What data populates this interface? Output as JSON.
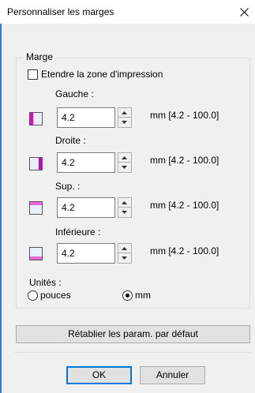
{
  "window": {
    "title": "Personnaliser les marges"
  },
  "close_icon": "close-icon",
  "group": {
    "legend": "Marge",
    "extend_checkbox": {
      "label": "Etendre la zone d'impression",
      "checked": false
    }
  },
  "margins": [
    {
      "label": "Gauche :",
      "value": "4.2",
      "range": "mm [4.2 - 100.0]",
      "icon": "margin-left-icon",
      "highlight_color": "#e800c8"
    },
    {
      "label": "Droite :",
      "value": "4.2",
      "range": "mm [4.2 - 100.0]",
      "icon": "margin-right-icon",
      "highlight_color": "#c800c8"
    },
    {
      "label": "Sup. :",
      "value": "4.2",
      "range": "mm [4.2 - 100.0]",
      "icon": "margin-top-icon",
      "highlight_color": "#e868d8"
    },
    {
      "label": "Inférieure :",
      "value": "4.2",
      "range": "mm [4.2 - 100.0]",
      "icon": "margin-bottom-icon",
      "highlight_color": "#e868d8"
    }
  ],
  "units": {
    "label": "Unités :",
    "options": [
      {
        "label": "pouces",
        "selected": false
      },
      {
        "label": "mm",
        "selected": true
      }
    ]
  },
  "buttons": {
    "reset": "Rétablier les param. par défaut",
    "ok": "OK",
    "cancel": "Annuler"
  },
  "colors": {
    "window_accent": "#3c78c8",
    "dialog_bg": "#f0f0f0",
    "default_button_border": "#0078d7"
  }
}
